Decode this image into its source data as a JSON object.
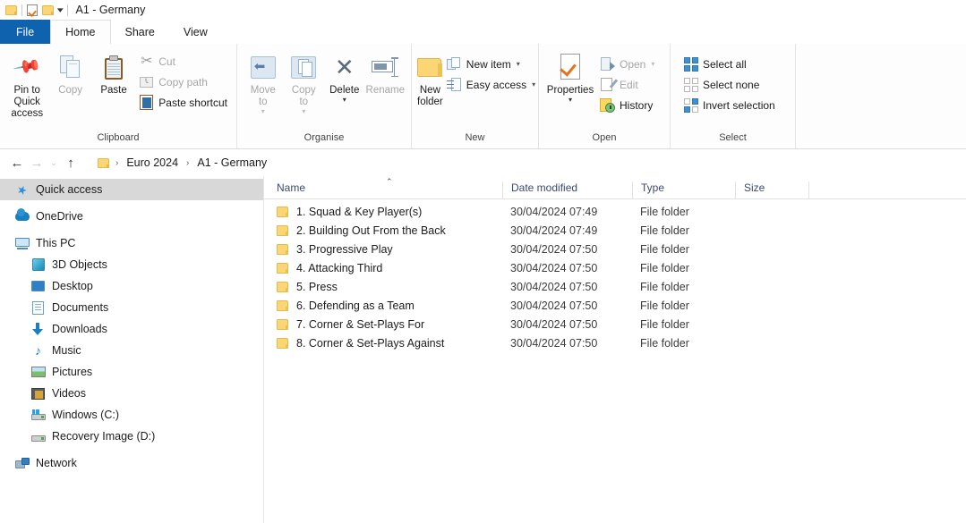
{
  "window": {
    "title": "A1 - Germany",
    "quick_access_toolbar": [
      {
        "name": "folder-properties-icon",
        "label": "Properties"
      },
      {
        "name": "new-folder-icon",
        "label": "New folder"
      },
      {
        "name": "customize-qat-caret",
        "label": "Customise Quick Access Toolbar"
      }
    ]
  },
  "tabs": [
    {
      "id": "file",
      "label": "File"
    },
    {
      "id": "home",
      "label": "Home"
    },
    {
      "id": "share",
      "label": "Share"
    },
    {
      "id": "view",
      "label": "View"
    }
  ],
  "ribbon": {
    "groups": [
      {
        "label": "Clipboard",
        "big_buttons": [
          {
            "label_line1": "Pin to Quick",
            "label_line2": "access",
            "icon": "pin-icon",
            "disabled": false
          },
          {
            "label_line1": "Copy",
            "label_line2": "",
            "icon": "copy-icon",
            "disabled": true
          },
          {
            "label_line1": "Paste",
            "label_line2": "",
            "icon": "paste-icon",
            "disabled": false
          }
        ],
        "small_buttons": [
          {
            "label": "Cut",
            "icon": "scissors-icon",
            "disabled": true
          },
          {
            "label": "Copy path",
            "icon": "copy-path-icon",
            "disabled": true
          },
          {
            "label": "Paste shortcut",
            "icon": "paste-shortcut-icon",
            "disabled": false
          }
        ]
      },
      {
        "label": "Organise",
        "big_buttons": [
          {
            "label_line1": "Move",
            "label_line2": "to",
            "icon": "move-to-icon",
            "disabled": true,
            "caret": true
          },
          {
            "label_line1": "Copy",
            "label_line2": "to",
            "icon": "copy-to-icon",
            "disabled": true,
            "caret": true
          },
          {
            "label_line1": "Delete",
            "label_line2": "",
            "icon": "delete-icon",
            "disabled": false,
            "caret": true
          },
          {
            "label_line1": "Rename",
            "label_line2": "",
            "icon": "rename-icon",
            "disabled": true
          }
        ],
        "small_buttons": []
      },
      {
        "label": "New",
        "big_buttons": [
          {
            "label_line1": "New",
            "label_line2": "folder",
            "icon": "new-folder-icon",
            "disabled": false
          }
        ],
        "small_buttons": [
          {
            "label": "New item",
            "icon": "new-item-icon",
            "disabled": false,
            "caret": true
          },
          {
            "label": "Easy access",
            "icon": "easy-access-icon",
            "disabled": false,
            "caret": true
          }
        ]
      },
      {
        "label": "Open",
        "big_buttons": [
          {
            "label_line1": "Properties",
            "label_line2": "",
            "icon": "properties-icon",
            "disabled": false,
            "caret": true
          }
        ],
        "small_buttons": [
          {
            "label": "Open",
            "icon": "open-icon",
            "disabled": true,
            "caret": true
          },
          {
            "label": "Edit",
            "icon": "edit-icon",
            "disabled": true
          },
          {
            "label": "History",
            "icon": "history-icon",
            "disabled": false
          }
        ]
      },
      {
        "label": "Select",
        "big_buttons": [],
        "small_buttons": [
          {
            "label": "Select all",
            "icon": "select-all-icon",
            "disabled": false
          },
          {
            "label": "Select none",
            "icon": "select-none-icon",
            "disabled": false
          },
          {
            "label": "Invert selection",
            "icon": "invert-selection-icon",
            "disabled": false
          }
        ]
      }
    ]
  },
  "address_bar": {
    "back": "←",
    "forward": "→",
    "recent": "⌄",
    "up": "↑",
    "breadcrumbs": [
      "Euro 2024",
      "A1 - Germany"
    ],
    "separator": "›"
  },
  "sidebar": {
    "items": [
      {
        "label": "Quick access",
        "icon": "quick-access-star-icon",
        "level": 1,
        "selected": true
      },
      {
        "label": "OneDrive",
        "icon": "onedrive-cloud-icon",
        "level": 1,
        "selected": false
      },
      {
        "label": "This PC",
        "icon": "this-pc-monitor-icon",
        "level": 1,
        "selected": false
      },
      {
        "label": "3D Objects",
        "icon": "3d-objects-icon",
        "level": 2,
        "selected": false
      },
      {
        "label": "Desktop",
        "icon": "desktop-icon",
        "level": 2,
        "selected": false
      },
      {
        "label": "Documents",
        "icon": "documents-icon",
        "level": 2,
        "selected": false
      },
      {
        "label": "Downloads",
        "icon": "downloads-arrow-icon",
        "level": 2,
        "selected": false
      },
      {
        "label": "Music",
        "icon": "music-note-icon",
        "level": 2,
        "selected": false
      },
      {
        "label": "Pictures",
        "icon": "pictures-icon",
        "level": 2,
        "selected": false
      },
      {
        "label": "Videos",
        "icon": "videos-icon",
        "level": 2,
        "selected": false
      },
      {
        "label": "Windows (C:)",
        "icon": "windows-drive-icon",
        "level": 2,
        "selected": false
      },
      {
        "label": "Recovery Image (D:)",
        "icon": "drive-icon",
        "level": 2,
        "selected": false
      },
      {
        "label": "Network",
        "icon": "network-icon",
        "level": 1,
        "selected": false
      }
    ]
  },
  "file_list": {
    "columns": [
      {
        "label": "Name",
        "sorted": "asc"
      },
      {
        "label": "Date modified",
        "sorted": null
      },
      {
        "label": "Type",
        "sorted": null
      },
      {
        "label": "Size",
        "sorted": null
      }
    ],
    "sort_indicator": "⌃",
    "rows": [
      {
        "name": "1. Squad & Key Player(s)",
        "date_modified": "30/04/2024 07:49",
        "type": "File folder",
        "size": "",
        "icon": "folder-icon"
      },
      {
        "name": "2. Building Out From the Back",
        "date_modified": "30/04/2024 07:49",
        "type": "File folder",
        "size": "",
        "icon": "folder-icon"
      },
      {
        "name": "3. Progressive Play",
        "date_modified": "30/04/2024 07:50",
        "type": "File folder",
        "size": "",
        "icon": "folder-icon"
      },
      {
        "name": "4. Attacking Third",
        "date_modified": "30/04/2024 07:50",
        "type": "File folder",
        "size": "",
        "icon": "folder-icon"
      },
      {
        "name": "5. Press",
        "date_modified": "30/04/2024 07:50",
        "type": "File folder",
        "size": "",
        "icon": "folder-icon"
      },
      {
        "name": "6. Defending as a Team",
        "date_modified": "30/04/2024 07:50",
        "type": "File folder",
        "size": "",
        "icon": "folder-icon"
      },
      {
        "name": "7. Corner & Set-Plays For",
        "date_modified": "30/04/2024 07:50",
        "type": "File folder",
        "size": "",
        "icon": "folder-icon"
      },
      {
        "name": "8. Corner & Set-Plays Against",
        "date_modified": "30/04/2024 07:50",
        "type": "File folder",
        "size": "",
        "icon": "folder-icon"
      }
    ]
  },
  "colors": {
    "file_tab_blue": "#0f62ad",
    "folder_yellow": "#fcd675",
    "selection_grey": "#d8d8d8",
    "column_header_text": "#3b4a6b",
    "disabled_text": "#a6a6a6"
  }
}
